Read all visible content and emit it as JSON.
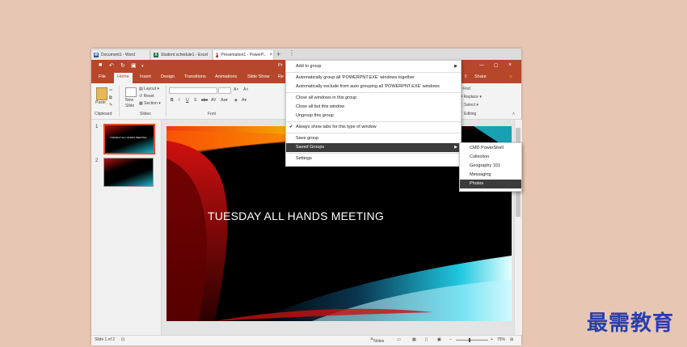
{
  "tabs": [
    {
      "icon": "W",
      "icon_color": "#2b579a",
      "label": "Document1 - Word"
    },
    {
      "icon": "X",
      "icon_color": "#217346",
      "label": "Student schedule1 - Excel"
    },
    {
      "icon": "P",
      "icon_color": "#b7472a",
      "label": "Presentation1 - PowerP..."
    }
  ],
  "qat": {
    "title_fragment": "Pr"
  },
  "ribbon_tabs": [
    "File",
    "Home",
    "Insert",
    "Design",
    "Transitions",
    "Animations",
    "Slide Show",
    "Re"
  ],
  "ribbon_right": {
    "share": "Share"
  },
  "ribbon": {
    "paste": "Paste",
    "new_slide": "New\nSlide",
    "layout": "Layout",
    "reset": "Reset",
    "section": "Section",
    "clipboard": "Clipboard",
    "slides": "Slides",
    "font": "Font",
    "find": "Find",
    "replace": "Replace",
    "select": "Select",
    "editing": "Editing"
  },
  "thumbnails": [
    {
      "num": "1",
      "text": "TUESDAY ALL HANDS MEETING"
    },
    {
      "num": "2",
      "text": ""
    }
  ],
  "slide": {
    "title": "TUESDAY ALL HANDS MEETING"
  },
  "status": {
    "slide_count": "Slide 1 of 2",
    "notes": "Notes",
    "zoom": "75%"
  },
  "context_menu": {
    "items": [
      {
        "label": "Add to group",
        "submenu": true
      },
      {
        "label": "Automatically group all 'POWERPNT.EXE' windows together"
      },
      {
        "label": "Automatically exclude from auto grouping all 'POWERPNT.EXE' windows"
      },
      {
        "label": "Close all windows in this group"
      },
      {
        "label": "Close all but this window"
      },
      {
        "label": "Ungroup this group"
      },
      {
        "label": "Always show tabs for this type of window",
        "checked": true
      },
      {
        "label": "Save group"
      },
      {
        "label": "Saved Groups",
        "submenu": true,
        "highlighted": true
      },
      {
        "label": "Settings"
      }
    ]
  },
  "saved_groups": [
    {
      "label": "CMD  PowerShell"
    },
    {
      "label": "Collection"
    },
    {
      "label": "Geography 101"
    },
    {
      "label": "Messaging"
    },
    {
      "label": "Photos",
      "highlighted": true
    }
  ],
  "watermark": "最需教育"
}
